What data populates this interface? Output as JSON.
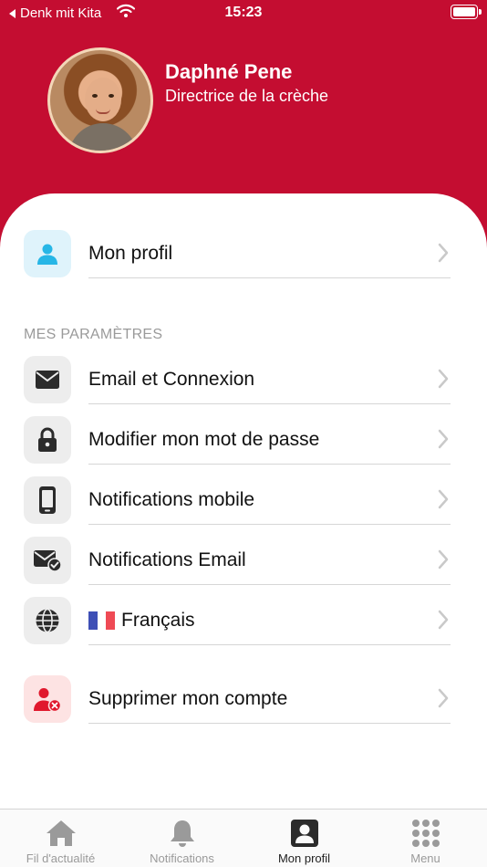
{
  "status_bar": {
    "carrier": "Denk mit Kita",
    "time": "15:23"
  },
  "profile": {
    "name": "Daphné Pene",
    "role": "Directrice de la crèche"
  },
  "menu": {
    "profile_item": {
      "label": "Mon profil",
      "icon": "person-icon"
    },
    "section_title": "MES PARAMÈTRES",
    "settings": [
      {
        "label": "Email et Connexion",
        "icon": "envelope-icon"
      },
      {
        "label": "Modifier mon mot de passe",
        "icon": "lock-icon"
      },
      {
        "label": "Notifications mobile",
        "icon": "smartphone-icon"
      },
      {
        "label": "Notifications Email",
        "icon": "envelope-check-icon"
      },
      {
        "label": "Français",
        "icon": "globe-icon",
        "flag": "fr"
      }
    ],
    "delete_item": {
      "label": "Supprimer mon compte",
      "icon": "user-remove-icon"
    }
  },
  "tabs": [
    {
      "label": "Fil d'actualité",
      "icon": "home-icon",
      "active": false
    },
    {
      "label": "Notifications",
      "icon": "bell-icon",
      "active": false
    },
    {
      "label": "Mon profil",
      "icon": "profile-card-icon",
      "active": true
    },
    {
      "label": "Menu",
      "icon": "grid-icon",
      "active": false
    }
  ],
  "colors": {
    "brand_red": "#c40d31",
    "profile_icon_bg": "#dff3fb",
    "profile_icon": "#27b6e6",
    "delete_icon_bg": "#fde3e3",
    "delete_icon": "#e0182d",
    "icon_dark": "#2b2b2b"
  }
}
